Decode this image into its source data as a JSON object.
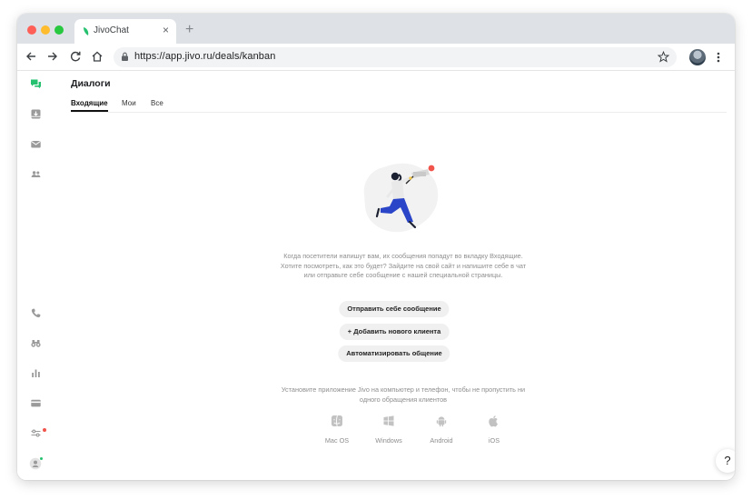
{
  "browser": {
    "tab_title": "JivoChat",
    "tab_close": "×",
    "new_tab": "+",
    "url": "https://app.jivo.ru/deals/kanban"
  },
  "colors": {
    "accent": "#25c16f",
    "notification": "#f0544a",
    "illustration_blue": "#2a45c8"
  },
  "sidebar": {
    "top_items": [
      {
        "icon": "chat-bubbles-icon",
        "active": true
      },
      {
        "icon": "inbox-download-icon"
      },
      {
        "icon": "envelope-icon"
      },
      {
        "icon": "contacts-icon"
      }
    ],
    "bottom_items": [
      {
        "icon": "phone-icon"
      },
      {
        "icon": "binoculars-icon"
      },
      {
        "icon": "bar-chart-icon"
      },
      {
        "icon": "credit-card-icon"
      },
      {
        "icon": "settings-sliders-icon",
        "badge": true
      },
      {
        "icon": "user-avatar-icon",
        "status": "online"
      }
    ]
  },
  "main": {
    "title": "Диалоги",
    "tabs": [
      {
        "label": "Входящие",
        "active": true
      },
      {
        "label": "Мои"
      },
      {
        "label": "Все"
      }
    ],
    "empty_state": {
      "lines": [
        "Когда посетители напишут вам, их сообщения попадут во вкладку Входящие.",
        "Хотите посмотреть, как это будет? Зайдите на свой сайт и напишите себе в чат",
        "или отправьте себе сообщение с нашей специальной страницы."
      ],
      "buttons": [
        "Отправить себе сообщение",
        "+ Добавить нового клиента",
        "Автоматизировать общение"
      ]
    },
    "apps": {
      "lines": [
        "Установите приложение Jivo на компьютер и телефон, чтобы не пропустить ни",
        "одного обращения клиентов"
      ],
      "items": [
        {
          "label": "Mac OS",
          "icon": "finder-icon"
        },
        {
          "label": "Windows",
          "icon": "windows-icon"
        },
        {
          "label": "Android",
          "icon": "android-icon"
        },
        {
          "label": "iOS",
          "icon": "apple-icon"
        }
      ]
    },
    "help_label": "?"
  }
}
